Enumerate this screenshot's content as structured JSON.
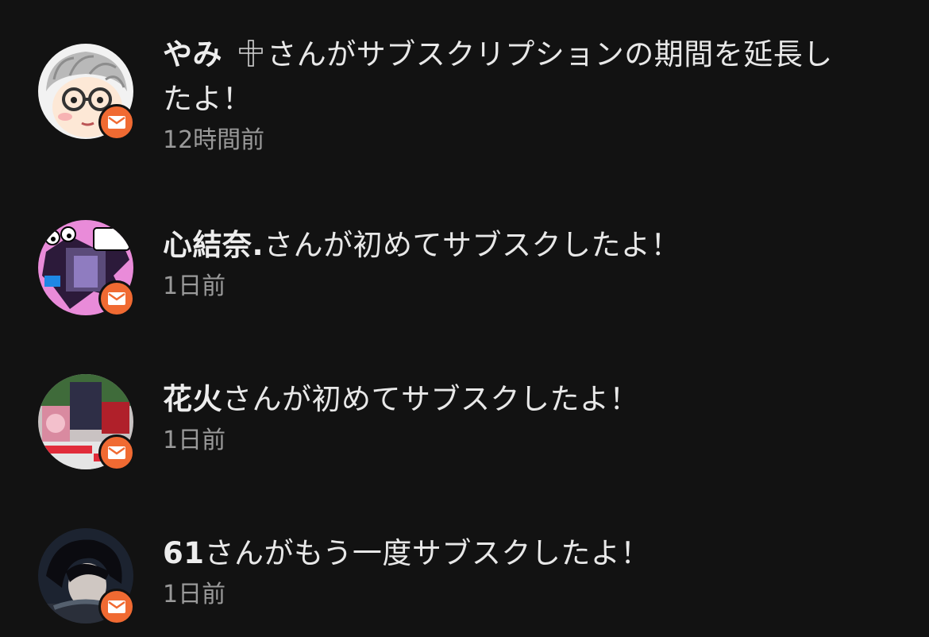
{
  "notifications": [
    {
      "username": "やみ",
      "message": "さんがサブスクリプションの期間を延長し",
      "message_cont": "たよ！",
      "time": "12時間前",
      "avatar": "cartoon-glasses-avatar",
      "badge_icon": "mail-icon"
    },
    {
      "username": "心結奈.",
      "message": "さんが初めてサブスクしたよ！",
      "time": "1日前",
      "avatar": "pink-collage-avatar",
      "badge_icon": "mail-icon"
    },
    {
      "username": "花火",
      "message": "さんが初めてサブスクしたよ！",
      "time": "1日前",
      "avatar": "red-collage-avatar",
      "badge_icon": "mail-icon"
    },
    {
      "username": "61",
      "message": "さんがもう一度サブスクしたよ！",
      "time": "1日前",
      "avatar": "dark-photo-avatar",
      "badge_icon": "mail-icon"
    }
  ],
  "colors": {
    "background": "#121212",
    "badge": "#f06a32",
    "text": "#e8e8e8",
    "muted": "#9a9a9a"
  }
}
